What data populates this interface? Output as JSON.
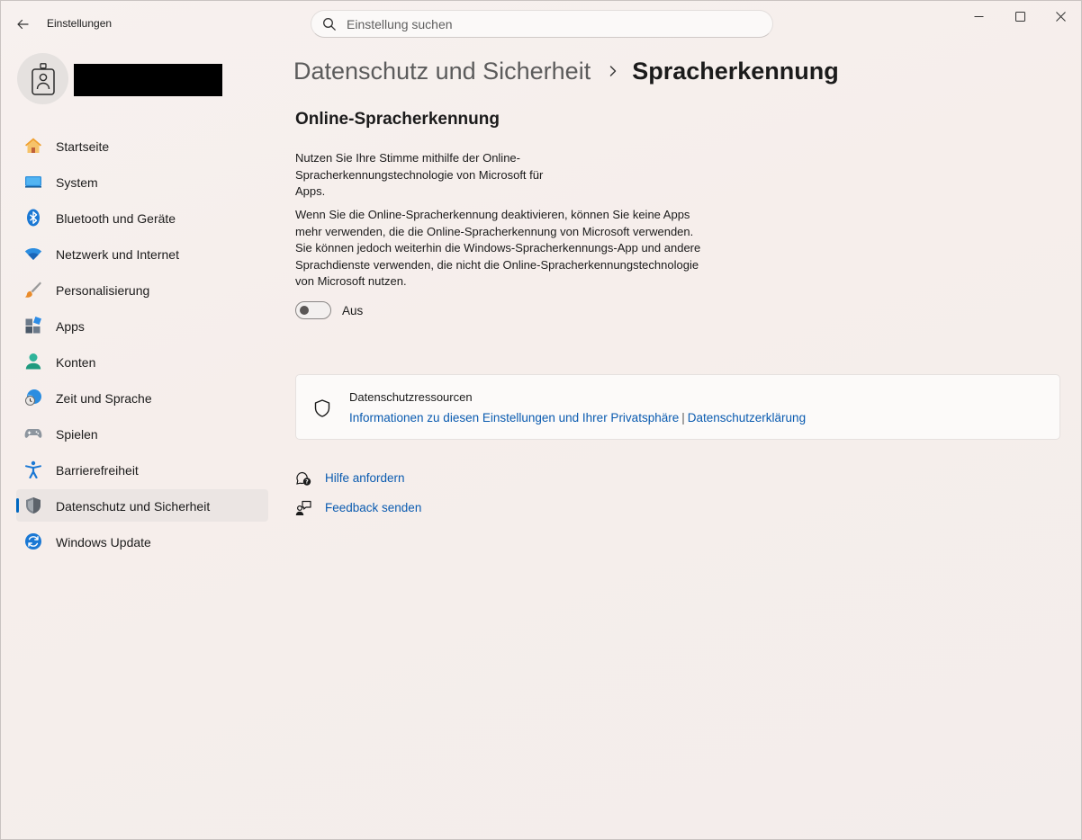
{
  "window": {
    "app_title": "Einstellungen",
    "search_placeholder": "Einstellung suchen"
  },
  "sidebar": {
    "items": [
      {
        "label": "Startseite",
        "icon": "home-icon"
      },
      {
        "label": "System",
        "icon": "monitor-icon"
      },
      {
        "label": "Bluetooth und Geräte",
        "icon": "bluetooth-icon"
      },
      {
        "label": "Netzwerk und Internet",
        "icon": "wifi-icon"
      },
      {
        "label": "Personalisierung",
        "icon": "brush-icon"
      },
      {
        "label": "Apps",
        "icon": "apps-icon"
      },
      {
        "label": "Konten",
        "icon": "account-icon"
      },
      {
        "label": "Zeit und Sprache",
        "icon": "globe-clock-icon"
      },
      {
        "label": "Spielen",
        "icon": "gamepad-icon"
      },
      {
        "label": "Barrierefreiheit",
        "icon": "accessibility-icon"
      },
      {
        "label": "Datenschutz und Sicherheit",
        "icon": "shield-icon",
        "active": true
      },
      {
        "label": "Windows Update",
        "icon": "update-icon"
      }
    ]
  },
  "breadcrumb": {
    "parent": "Datenschutz und Sicherheit",
    "current": "Spracherkennung"
  },
  "main": {
    "section_title": "Online-Spracherkennung",
    "intro_text": "Nutzen Sie Ihre Stimme mithilfe der Online-Spracherkennungstechnologie von Microsoft für Apps.",
    "detail_text": "Wenn Sie die Online-Spracherkennung deaktivieren, können Sie keine Apps mehr verwenden, die die Online-Spracherkennung von Microsoft verwenden. Sie können jedoch weiterhin die Windows-Spracherkennungs-App und andere Sprachdienste verwenden, die nicht die Online-Spracherkennungstechnologie von Microsoft nutzen.",
    "toggle": {
      "state": "off",
      "label": "Aus"
    }
  },
  "resources_card": {
    "title": "Datenschutzressourcen",
    "link1": "Informationen zu diesen Einstellungen und Ihrer Privatsphäre",
    "separator": "|",
    "link2": "Datenschutzerklärung"
  },
  "help": {
    "get_help": "Hilfe anfordern",
    "feedback": "Feedback senden"
  },
  "colors": {
    "accent": "#0067c0",
    "link": "#0a5bb0"
  }
}
